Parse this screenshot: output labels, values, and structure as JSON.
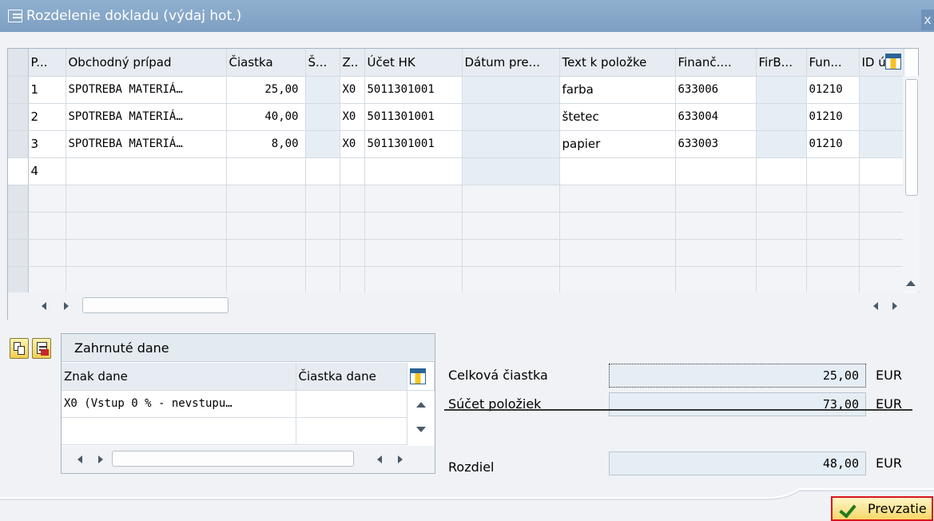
{
  "window": {
    "title": "Rozdelenie dokladu (výdaj hot.)",
    "close_glyph": "x"
  },
  "grid": {
    "headers": [
      "P...",
      "Obchodný prípad",
      "Čiastka",
      "Š...",
      "Z..",
      "Účet HK",
      "Dátum pre...",
      "Text k položke",
      "Finanč....",
      "FirB...",
      "Fun...",
      "ID ú.."
    ],
    "rows": [
      [
        "1",
        "SPOTREBA MATERIÁ…",
        "25,00",
        "",
        "X0",
        "5011301001",
        "",
        "farba",
        "633006",
        "",
        "01210",
        ""
      ],
      [
        "2",
        "SPOTREBA MATERIÁ…",
        "40,00",
        "",
        "X0",
        "5011301001",
        "",
        "štetec",
        "633004",
        "",
        "01210",
        ""
      ],
      [
        "3",
        "SPOTREBA MATERIÁ…",
        "8,00",
        "",
        "X0",
        "5011301001",
        "",
        "papier",
        "633003",
        "",
        "01210",
        ""
      ],
      [
        "4",
        "",
        "",
        "",
        "",
        "",
        "",
        "",
        "",
        "",
        "",
        ""
      ]
    ]
  },
  "tax": {
    "section_title": "Zahrnuté dane",
    "headers": [
      "Znak dane",
      "Čiastka dane"
    ],
    "row": [
      "X0 (Vstup 0 % - nevstupu…",
      ""
    ]
  },
  "totals": {
    "total_label": "Celková čiastka",
    "total_value": "25,00",
    "sum_label": "Súčet položiek",
    "sum_value": "73,00",
    "diff_label": "Rozdiel",
    "diff_value": "48,00",
    "currency": "EUR"
  },
  "buttons": {
    "accept_label": "Prevzatie"
  },
  "colors": {
    "title_bar": "#8fb0cf",
    "accept_border": "#d9141f",
    "field_bg": "#e6eef5"
  }
}
